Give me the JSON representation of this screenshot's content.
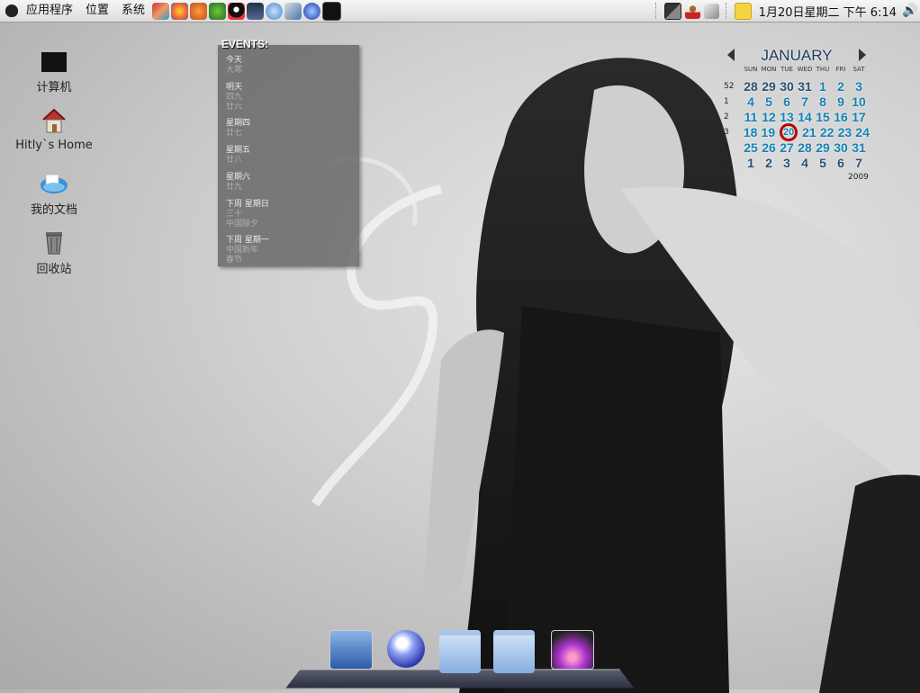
{
  "panel": {
    "menus": [
      "应用程序",
      "位置",
      "系统"
    ],
    "launchers": [
      "tool-icon",
      "swirl-icon",
      "basket-icon",
      "turtle-icon",
      "penguin-qq-icon",
      "photo-icon",
      "chat-bubble-icon",
      "pen-icon",
      "globe-icon",
      "terminal-icon"
    ],
    "tray": [
      "window-icon",
      "user-icon",
      "cursor-icon",
      "note-icon"
    ],
    "clock": "1月20日星期二 下午 6:14",
    "volume_icon": "speaker-icon"
  },
  "desktop_icons": [
    {
      "label": "计算机",
      "icon": "monitor-icon"
    },
    {
      "label": "Hitly`s Home",
      "icon": "home-icon"
    },
    {
      "label": "我的文档",
      "icon": "documents-icon"
    },
    {
      "label": "回收站",
      "icon": "trash-icon"
    }
  ],
  "events": {
    "title": "EVENTS:",
    "items": [
      {
        "head": "今天",
        "sub": "大寒"
      },
      {
        "head": "明天",
        "sub": "四九\n廿六"
      },
      {
        "head": "星期四",
        "sub": "廿七"
      },
      {
        "head": "星期五",
        "sub": "廿八"
      },
      {
        "head": "星期六",
        "sub": "廿九"
      },
      {
        "head": "下周 星期日",
        "sub": "三十\n中国除夕"
      },
      {
        "head": "下周 星期一",
        "sub": "中国新年\n春节"
      }
    ]
  },
  "calendar": {
    "month": "JANUARY",
    "year": "2009",
    "weekdays": [
      "SUN",
      "MON",
      "TUE",
      "WED",
      "THU",
      "FRI",
      "SAT"
    ],
    "weeks": [
      {
        "num": "52",
        "days": [
          "28",
          "29",
          "30",
          "31",
          "1",
          "2",
          "3"
        ]
      },
      {
        "num": "1",
        "days": [
          "4",
          "5",
          "6",
          "7",
          "8",
          "9",
          "10"
        ]
      },
      {
        "num": "2",
        "days": [
          "11",
          "12",
          "13",
          "14",
          "15",
          "16",
          "17"
        ]
      },
      {
        "num": "3",
        "days": [
          "18",
          "19",
          "20",
          "21",
          "22",
          "23",
          "24"
        ]
      },
      {
        "num": "4",
        "days": [
          "25",
          "26",
          "27",
          "28",
          "29",
          "30",
          "31"
        ]
      },
      {
        "num": "5",
        "days": [
          "1",
          "2",
          "3",
          "4",
          "5",
          "6",
          "7"
        ]
      }
    ],
    "today": "20",
    "today_color": "#b00000",
    "day_color": "#1482b4"
  },
  "dock": [
    "screenshot-icon",
    "browser-globe-icon",
    "folder-icon",
    "folder-icon",
    "photo-preview-icon"
  ]
}
